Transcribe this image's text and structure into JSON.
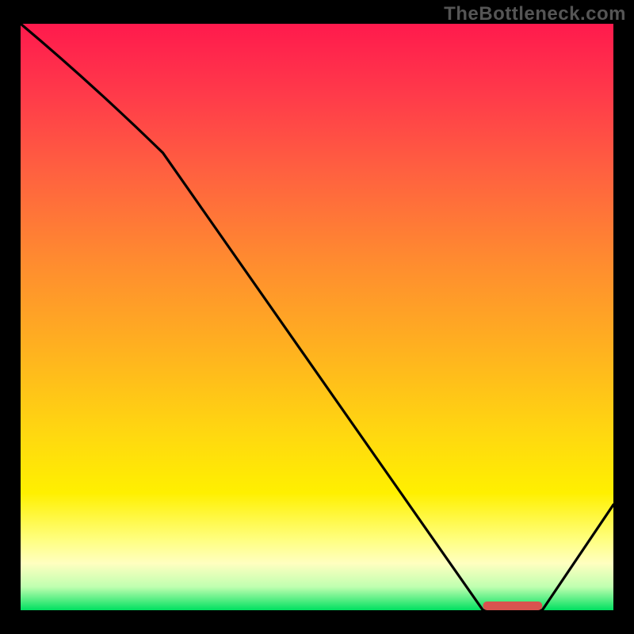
{
  "watermark": "TheBottleneck.com",
  "chart_data": {
    "type": "line",
    "title": "",
    "xlabel": "",
    "ylabel": "",
    "xlim": [
      0,
      100
    ],
    "ylim": [
      0,
      100
    ],
    "x": [
      0,
      24,
      78,
      88,
      100
    ],
    "values": [
      100,
      78,
      0,
      0,
      18
    ],
    "marker": {
      "x_start": 78,
      "x_end": 88,
      "y": 0
    },
    "gradient_stops": [
      {
        "pos": 0,
        "color": "#ff1a4d"
      },
      {
        "pos": 50,
        "color": "#ffb020"
      },
      {
        "pos": 85,
        "color": "#ffff00"
      },
      {
        "pos": 100,
        "color": "#00e060"
      }
    ]
  }
}
